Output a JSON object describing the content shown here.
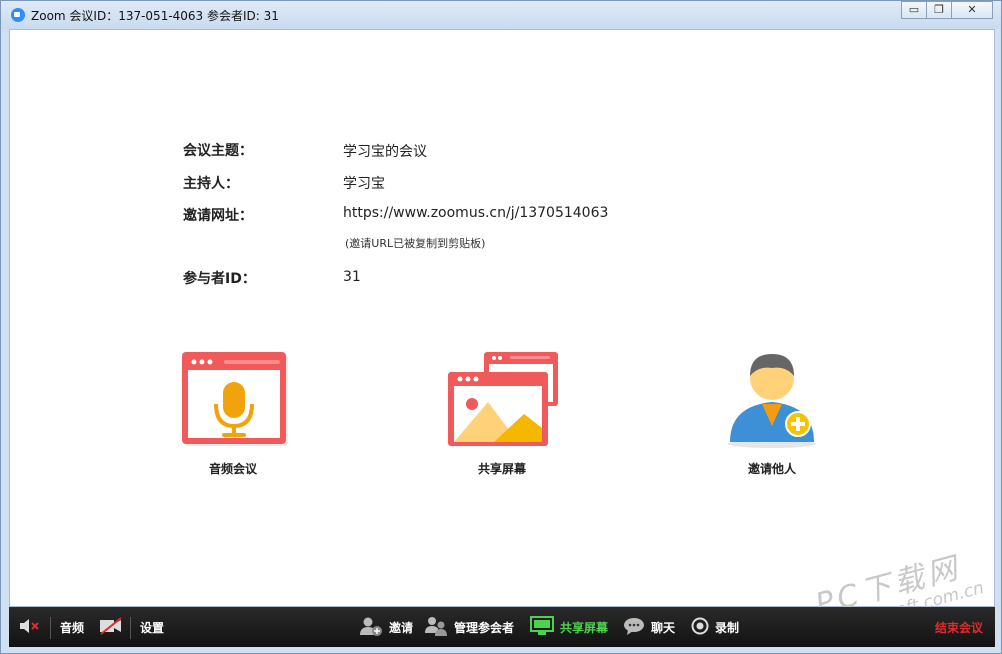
{
  "window": {
    "title": "Zoom 会议ID：137-051-4063 参会者ID: 31",
    "min_symbol": "▭",
    "restore_symbol": "❐",
    "close_symbol": "✕"
  },
  "meeting_info": {
    "topic_label": "会议主题：",
    "topic_value": "学习宝的会议",
    "host_label": "主持人：",
    "host_value": "学习宝",
    "url_label": "邀请网址：",
    "url_value": "https://www.zoomus.cn/j/1370514063",
    "url_note": "(邀请URL已被复制到剪贴板)",
    "participant_label": "参与者ID：",
    "participant_value": "31"
  },
  "features": [
    {
      "label": "音频会议",
      "icon": "microphone-icon"
    },
    {
      "label": "共享屏幕",
      "icon": "share-screen-icon"
    },
    {
      "label": "邀请他人",
      "icon": "invite-person-icon"
    }
  ],
  "toolbar": {
    "audio_label": "音频",
    "settings_label": "设置",
    "invite_label": "邀请",
    "manage_label": "管理参会者",
    "share_label": "共享屏幕",
    "chat_label": "聊天",
    "record_label": "录制",
    "end_label": "结束会议"
  },
  "watermark": {
    "text": "PC下载网",
    "url": "www.pcsoft.com.cn"
  },
  "colors": {
    "accent_red": "#f05a5b",
    "mic_yellow": "#f0a30a",
    "share_green": "#4fd14f",
    "end_red": "#e02b2b",
    "avatar_blue": "#3d8fd6"
  }
}
